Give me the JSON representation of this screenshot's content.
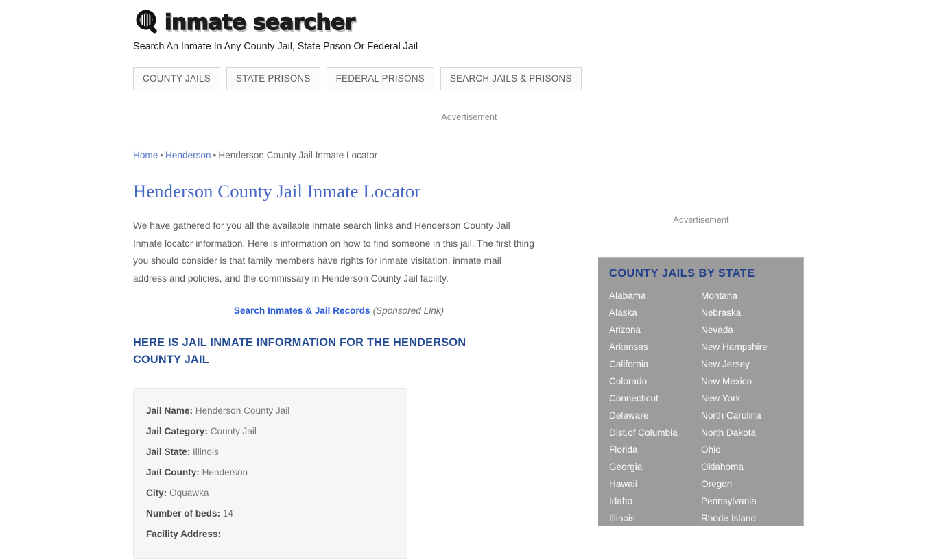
{
  "site": {
    "logo_text": "inmate searcher",
    "logo_icon": "magnifying-glass-jail-bars-icon",
    "tagline": "Search An Inmate In Any County Jail, State Prison Or Federal Jail"
  },
  "nav": {
    "items": [
      {
        "label": "COUNTY JAILS"
      },
      {
        "label": "STATE PRISONS"
      },
      {
        "label": "FEDERAL PRISONS"
      },
      {
        "label": "SEARCH JAILS & PRISONS"
      }
    ]
  },
  "ads": {
    "top_label": "Advertisement",
    "side_label": "Advertisement"
  },
  "breadcrumb": {
    "home": "Home",
    "county": "Henderson",
    "current": "Henderson County Jail Inmate Locator",
    "separator": "•"
  },
  "main": {
    "title": "Henderson County Jail Inmate Locator",
    "intro": "We have gathered for you all the available inmate search links and Henderson County Jail Inmate locator information. Here is information on how to find someone in this jail. The first thing you should consider is that family members have rights for inmate visitation, inmate mail address and policies, and the commissary in Henderson County Jail facility.",
    "sponsored_link": "Search Inmates & Jail Records",
    "sponsored_note": "(Sponsored Link)",
    "section_title": "HERE IS JAIL INMATE INFORMATION FOR THE HENDERSON COUNTY JAIL"
  },
  "info_card": {
    "rows": [
      {
        "label": "Jail Name:",
        "value": "Henderson County Jail"
      },
      {
        "label": "Jail Category:",
        "value": "County Jail"
      },
      {
        "label": "Jail State:",
        "value": "Illinois"
      },
      {
        "label": "Jail County:",
        "value": "Henderson"
      },
      {
        "label": "City:",
        "value": "Oquawka"
      },
      {
        "label": "Number of beds:",
        "value": "14"
      },
      {
        "label": "Facility Address:",
        "value": ""
      }
    ]
  },
  "sidebar": {
    "title": "COUNTY JAILS BY STATE",
    "column_left": [
      "Alabama",
      "Alaska",
      "Arizona",
      "Arkansas",
      "California",
      "Colorado",
      "Connecticut",
      "Delaware",
      "Dist.of Columbia",
      "Florida",
      "Georgia",
      "Hawaii",
      "Idaho",
      "Illinois"
    ],
    "column_right": [
      "Montana",
      "Nebraska",
      "Nevada",
      "New Hampshire",
      "New Jersey",
      "New Mexico",
      "New York",
      "North Carolina",
      "North Dakota",
      "Ohio",
      "Oklahoma",
      "Oregon",
      "Pennsylvania",
      "Rhode Island"
    ]
  },
  "colors": {
    "link_blue": "#5a76c8",
    "title_blue": "#4568c6",
    "heading_navy": "#234a94",
    "sponsored_blue": "#2a5bd7",
    "sidebar_bg": "#9c9c9c",
    "card_bg": "#f6f6f6"
  }
}
